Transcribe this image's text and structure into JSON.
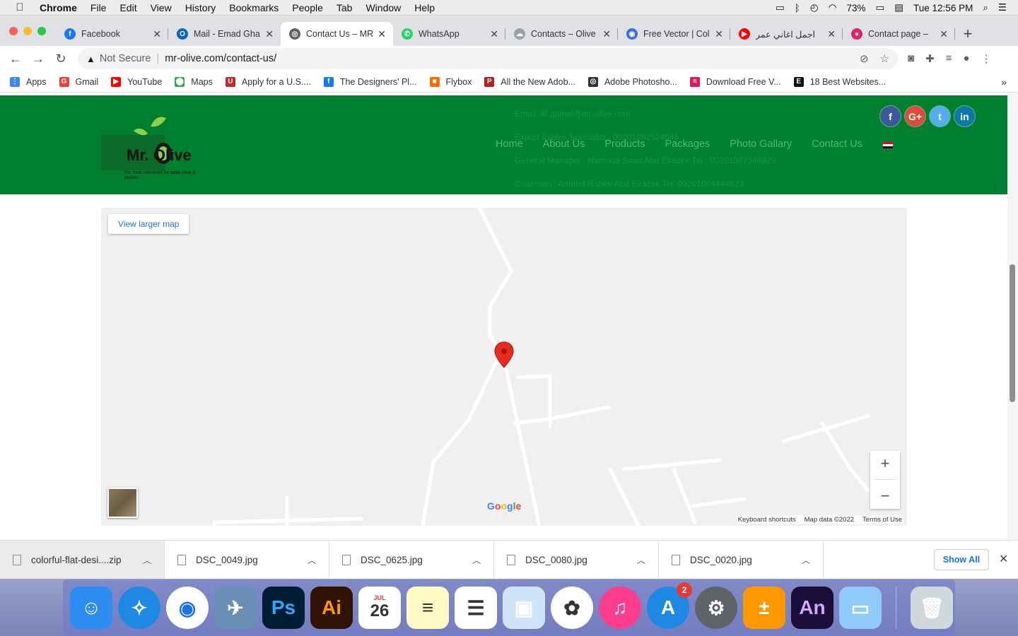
{
  "menubar": {
    "app": "Chrome",
    "items": [
      "File",
      "Edit",
      "View",
      "History",
      "Bookmarks",
      "People",
      "Tab",
      "Window",
      "Help"
    ],
    "battery": "73%",
    "clock": "Tue 12:56 PM"
  },
  "tabs": [
    {
      "title": "Facebook",
      "color": "#1877f2",
      "glyph": "f"
    },
    {
      "title": "Mail - Emad Gha",
      "color": "#0a64c2",
      "glyph": "O"
    },
    {
      "title": "Contact Us – MR",
      "color": "#5f6368",
      "glyph": "◎"
    },
    {
      "title": "WhatsApp",
      "color": "#25d366",
      "glyph": "✆"
    },
    {
      "title": "Contacts – Olive",
      "color": "#9aa0a6",
      "glyph": "☁"
    },
    {
      "title": "Free Vector | Col",
      "color": "#3b6fd8",
      "glyph": "◉"
    },
    {
      "title": "اجمل اغاني عمر",
      "color": "#ff0000",
      "glyph": "▶"
    },
    {
      "title": "Contact page –",
      "color": "#e91e63",
      "glyph": "●"
    }
  ],
  "omnibox": {
    "security": "Not Secure",
    "url": "mr-olive.com/contact-us/"
  },
  "bookmarks": [
    {
      "label": "Apps",
      "color": "#4285f4",
      "glyph": "⋮"
    },
    {
      "label": "Gmail",
      "color": "#ea4335",
      "glyph": "G"
    },
    {
      "label": "YouTube",
      "color": "#ff0000",
      "glyph": "▶"
    },
    {
      "label": "Maps",
      "color": "#34a853",
      "glyph": "⬤"
    },
    {
      "label": "Apply for a U.S....",
      "color": "#c62828",
      "glyph": "U"
    },
    {
      "label": "The Designers' Pl...",
      "color": "#1877f2",
      "glyph": "f"
    },
    {
      "label": "Flybox",
      "color": "#ff6d00",
      "glyph": "■"
    },
    {
      "label": "All the New Adob...",
      "color": "#b71c1c",
      "glyph": "P"
    },
    {
      "label": "Adobe Photosho...",
      "color": "#333333",
      "glyph": "◎"
    },
    {
      "label": "Download Free V...",
      "color": "#d81b60",
      "glyph": "≡"
    },
    {
      "label": "18 Best Websites...",
      "color": "#111111",
      "glyph": "E"
    }
  ],
  "site": {
    "logo_text": "Mr. Olive",
    "logo_tagline": "For food industries for table olive & pickles",
    "nav": [
      "Home",
      "About Us",
      "Products",
      "Packages",
      "Photo Gallary",
      "Contact Us"
    ],
    "ghost_lines": [
      "Email: M.gamal@mr-olive.com",
      "Export &sales Specialist : 00201062524946",
      "General Manager : Hamada Saad Abd Elrazek   Tel : 00201007546929",
      "Chairman : Ahmed Rabee Abd Elrazek  Tel: 00201004444823"
    ],
    "social": [
      {
        "name": "facebook",
        "glyph": "f",
        "color": "#3b5998"
      },
      {
        "name": "google-plus",
        "glyph": "G+",
        "color": "#dd4b39"
      },
      {
        "name": "twitter",
        "glyph": "t",
        "color": "#55acee"
      },
      {
        "name": "linkedin",
        "glyph": "in",
        "color": "#0e76a8"
      }
    ]
  },
  "map": {
    "view_larger": "View larger map",
    "zoom_in": "+",
    "zoom_out": "−",
    "google": "Google",
    "keyboard": "Keyboard shortcuts",
    "mapdata": "Map data ©2022",
    "terms": "Terms of Use"
  },
  "downloads": {
    "items": [
      "colorful-flat-desi....zip",
      "DSC_0049.jpg",
      "DSC_0625.jpg",
      "DSC_0080.jpg",
      "DSC_0020.jpg"
    ],
    "show_all": "Show All"
  },
  "dock": [
    {
      "name": "finder",
      "bg": "#2d8cf0",
      "glyph": "☺"
    },
    {
      "name": "safari",
      "bg": "#1e88e5",
      "glyph": "✧"
    },
    {
      "name": "chrome",
      "bg": "#ffffff",
      "glyph": "◉"
    },
    {
      "name": "preview-eagle",
      "bg": "#6a8fb5",
      "glyph": "✈"
    },
    {
      "name": "photoshop",
      "bg": "#001d34",
      "glyph": "Ps"
    },
    {
      "name": "illustrator",
      "bg": "#2f1200",
      "glyph": "Ai"
    },
    {
      "name": "calendar",
      "bg": "#ffffff",
      "glyph": "26"
    },
    {
      "name": "notes",
      "bg": "#fff9c4",
      "glyph": "≡"
    },
    {
      "name": "reminders",
      "bg": "#ffffff",
      "glyph": "☰"
    },
    {
      "name": "preview",
      "bg": "#d0e4f7",
      "glyph": "▣"
    },
    {
      "name": "photos",
      "bg": "#ffffff",
      "glyph": "✿"
    },
    {
      "name": "music",
      "bg": "#fc3c8d",
      "glyph": "♫"
    },
    {
      "name": "app-store",
      "bg": "#1e88e5",
      "glyph": "A"
    },
    {
      "name": "system-preferences",
      "bg": "#5f6368",
      "glyph": "⚙"
    },
    {
      "name": "calculator",
      "bg": "#ff9800",
      "glyph": "±"
    },
    {
      "name": "animate",
      "bg": "#1a0d38",
      "glyph": "An"
    },
    {
      "name": "image-capture",
      "bg": "#90caf9",
      "glyph": "▭"
    },
    {
      "name": "trash",
      "bg": "#cfd8dc",
      "glyph": "🗑"
    }
  ],
  "app_store_badge": "2",
  "calendar_month": "JUL"
}
